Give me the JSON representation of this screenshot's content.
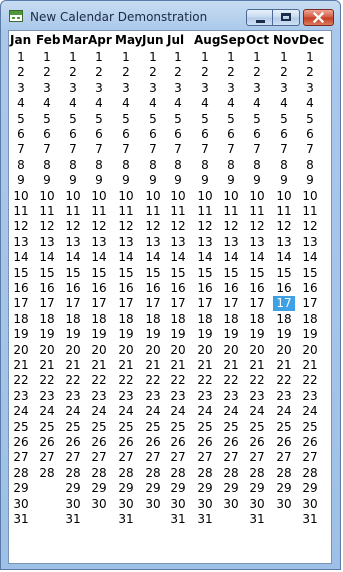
{
  "window": {
    "title": "New Calendar Demonstration",
    "accent": "#3ea1e6"
  },
  "icons": {
    "app": "calendar-app-icon",
    "minimize": "minimize-icon",
    "maximize": "maximize-icon",
    "close": "close-icon"
  },
  "months": [
    {
      "name": "Jan",
      "days": 31
    },
    {
      "name": "Feb",
      "days": 28
    },
    {
      "name": "Mar",
      "days": 31
    },
    {
      "name": "Apr",
      "days": 30
    },
    {
      "name": "May",
      "days": 31
    },
    {
      "name": "Jun",
      "days": 30
    },
    {
      "name": "Jul",
      "days": 31
    },
    {
      "name": "Aug",
      "days": 31
    },
    {
      "name": "Sep",
      "days": 30
    },
    {
      "name": "Oct",
      "days": 31
    },
    {
      "name": "Nov",
      "days": 30
    },
    {
      "name": "Dec",
      "days": 31
    }
  ],
  "selected": {
    "month": "Nov",
    "day": 17
  }
}
